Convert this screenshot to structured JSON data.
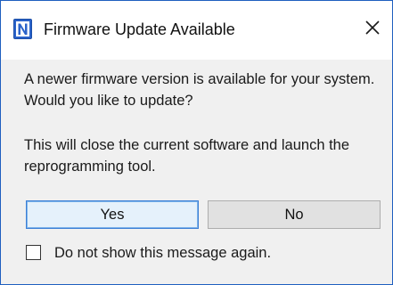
{
  "dialog": {
    "title": "Firmware Update Available",
    "app_icon": "app-logo-n-icon",
    "close_icon": "close-icon",
    "accent_color": "#1f5fbf"
  },
  "message": {
    "line1": "A newer firmware version is available for your system. Would you like to update?",
    "line2": "This will close the current software and launch the reprogramming tool."
  },
  "buttons": {
    "yes_label": "Yes",
    "no_label": "No"
  },
  "checkbox": {
    "label": "Do not show this message again.",
    "checked": false
  }
}
